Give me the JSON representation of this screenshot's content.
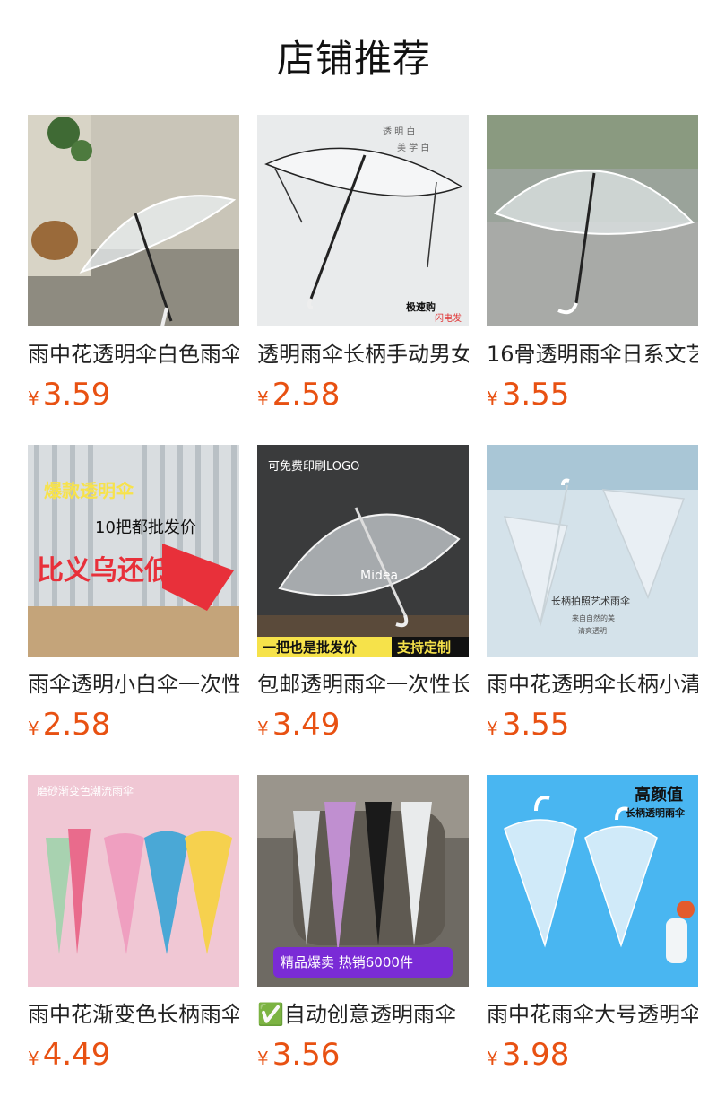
{
  "section": {
    "title": "店铺推荐"
  },
  "colors": {
    "price": "#e85112"
  },
  "products": [
    {
      "name": "雨中花透明伞白色雨伞",
      "currency": "¥",
      "price": "3.59",
      "image_icon": "umbrella-photo-icon",
      "image_text": []
    },
    {
      "name": "透明雨伞长柄手动男女",
      "currency": "¥",
      "price": "2.58",
      "image_icon": "umbrella-photo-icon",
      "image_text": [
        "透 明 白",
        "美 学 白",
        "极速购",
        "闪电发"
      ]
    },
    {
      "name": "16骨透明雨伞日系文艺",
      "currency": "¥",
      "price": "3.55",
      "image_icon": "umbrella-photo-icon",
      "image_text": []
    },
    {
      "name": "雨伞透明小白伞一次性",
      "currency": "¥",
      "price": "2.58",
      "image_icon": "umbrella-photo-icon",
      "image_text": [
        "爆款透明伞",
        "10把都批发价",
        "比义乌还低"
      ]
    },
    {
      "name": "包邮透明雨伞一次性长",
      "currency": "¥",
      "price": "3.49",
      "image_icon": "umbrella-photo-icon",
      "image_text": [
        "可免费印刷LOGO",
        "Midea",
        "一把也是批发价",
        "支持定制"
      ]
    },
    {
      "name": "雨中花透明伞长柄小清",
      "currency": "¥",
      "price": "3.55",
      "image_icon": "umbrella-photo-icon",
      "image_text": [
        "长柄拍照艺术雨伞",
        "来自自然的美",
        "清爽透明"
      ]
    },
    {
      "name": "雨中花渐变色长柄雨伞",
      "currency": "¥",
      "price": "4.49",
      "image_icon": "umbrella-photo-icon",
      "image_text": [
        "磨砂渐变色潮流雨伞"
      ]
    },
    {
      "name": "✅自动创意透明雨伞",
      "currency": "¥",
      "price": "3.56",
      "image_icon": "umbrella-photo-icon",
      "image_text": [
        "精品爆卖 热销6000件"
      ]
    },
    {
      "name": "雨中花雨伞大号透明伞",
      "currency": "¥",
      "price": "3.98",
      "image_icon": "umbrella-photo-icon",
      "image_text": [
        "高颜值",
        "长柄透明雨伞"
      ]
    }
  ]
}
